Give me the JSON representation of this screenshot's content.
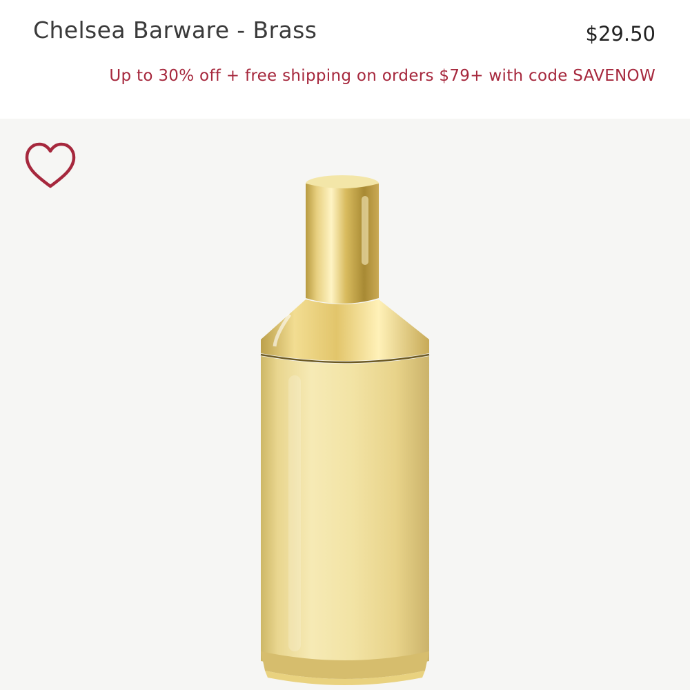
{
  "product": {
    "title": "Chelsea Barware - Brass",
    "price": "$29.50",
    "promo": "Up to 30% off + free shipping on orders $79+ with code SAVENOW",
    "image_subject": "brass cocktail shaker"
  },
  "favorite": {
    "icon": "heart-outline-icon"
  },
  "colors": {
    "promo": "#a6283d",
    "heart": "#a6283d",
    "title": "#3a3a3a",
    "price": "#222222",
    "image_background": "#f6f6f4",
    "brass": "#e6d28a"
  }
}
